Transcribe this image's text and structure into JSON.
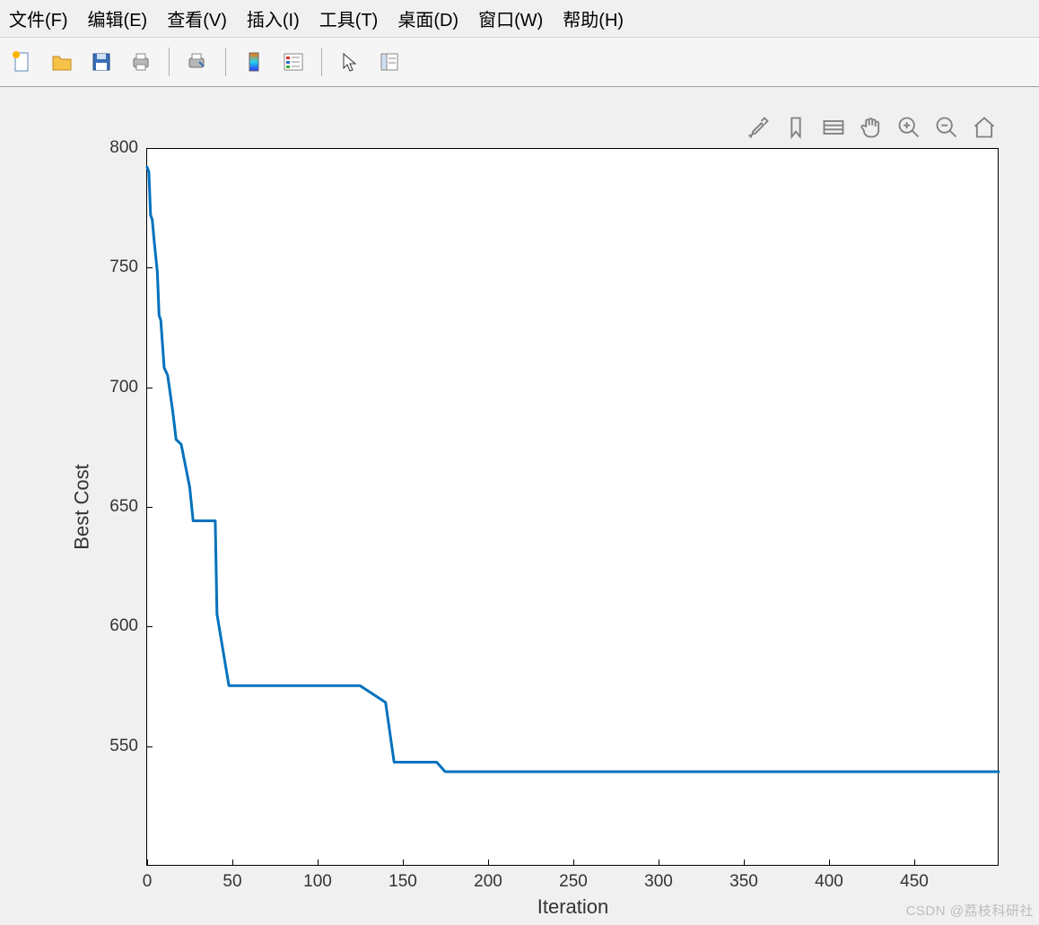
{
  "menubar": {
    "items": [
      "文件(F)",
      "编辑(E)",
      "查看(V)",
      "插入(I)",
      "工具(T)",
      "桌面(D)",
      "窗口(W)",
      "帮助(H)"
    ]
  },
  "toolbar": {
    "icons": [
      "new-file-icon",
      "open-folder-icon",
      "save-icon",
      "print-icon",
      "page-setup-icon",
      "colormap-icon",
      "legend-icon",
      "cursor-icon",
      "inspector-icon"
    ]
  },
  "figure_toolbar": {
    "icons": [
      "brush-icon",
      "data-tips-icon",
      "rotate-icon",
      "pan-hand-icon",
      "zoom-in-icon",
      "zoom-out-icon",
      "home-icon"
    ]
  },
  "watermark": "CSDN @荔枝科研社",
  "chart_data": {
    "type": "line",
    "title": "",
    "xlabel": "Iteration",
    "ylabel": "Best Cost",
    "xlim": [
      0,
      500
    ],
    "ylim": [
      500,
      800
    ],
    "xticks": [
      0,
      50,
      100,
      150,
      200,
      250,
      300,
      350,
      400,
      450
    ],
    "yticks": [
      550,
      600,
      650,
      700,
      750,
      800
    ],
    "grid": false,
    "line_color": "#0072BD",
    "series": [
      {
        "name": "Best Cost",
        "x": [
          0,
          1,
          2,
          3,
          4,
          5,
          6,
          7,
          8,
          10,
          12,
          15,
          17,
          20,
          25,
          27,
          30,
          40,
          41,
          48,
          120,
          125,
          140,
          145,
          170,
          175,
          500
        ],
        "y": [
          792,
          790,
          772,
          770,
          762,
          755,
          748,
          730,
          728,
          708,
          705,
          690,
          678,
          676,
          658,
          644,
          644,
          644,
          605,
          575,
          575,
          575,
          568,
          543,
          543,
          539,
          539
        ]
      }
    ]
  }
}
